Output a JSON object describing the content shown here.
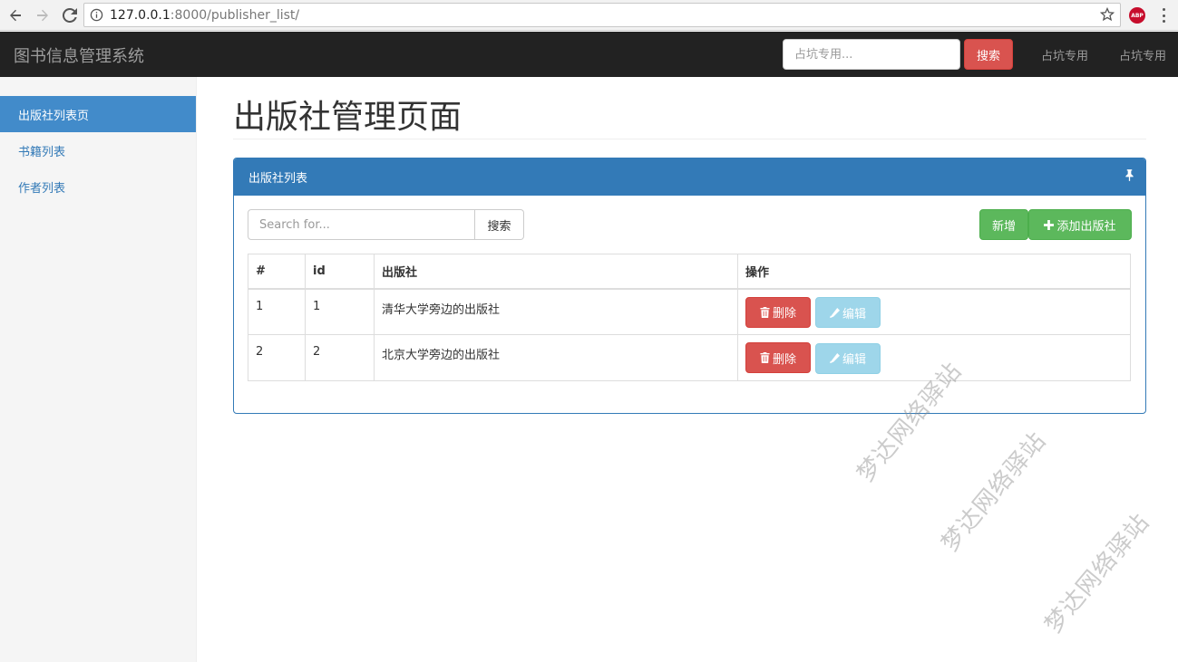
{
  "browser": {
    "url_host": "127.0.0.1",
    "url_rest": ":8000/publisher_list/",
    "extension_label": "ABP"
  },
  "navbar": {
    "brand": "图书信息管理系统",
    "search_placeholder": "占坑专用...",
    "search_button": "搜索",
    "links": [
      "占坑专用",
      "占坑专用"
    ]
  },
  "sidebar": {
    "items": [
      {
        "label": "出版社列表页",
        "active": true
      },
      {
        "label": "书籍列表",
        "active": false
      },
      {
        "label": "作者列表",
        "active": false
      }
    ]
  },
  "main": {
    "title": "出版社管理页面",
    "panel": {
      "heading": "出版社列表",
      "search_placeholder": "Search for...",
      "search_button": "搜索",
      "new_button": "新增",
      "add_button": "添加出版社",
      "columns": [
        "#",
        "id",
        "出版社",
        "操作"
      ],
      "rows": [
        {
          "index": "1",
          "id": "1",
          "name": "清华大学旁边的出版社",
          "delete_label": "删除",
          "edit_label": "编辑"
        },
        {
          "index": "2",
          "id": "2",
          "name": "北京大学旁边的出版社",
          "delete_label": "删除",
          "edit_label": "编辑"
        }
      ]
    }
  },
  "watermark": "梦达网络驿站",
  "colors": {
    "navbar_bg": "#222222",
    "primary": "#337ab7",
    "sidebar_active": "#428bca",
    "danger": "#d9534f",
    "success": "#5cb85c",
    "info_light": "#9ed6ea"
  }
}
